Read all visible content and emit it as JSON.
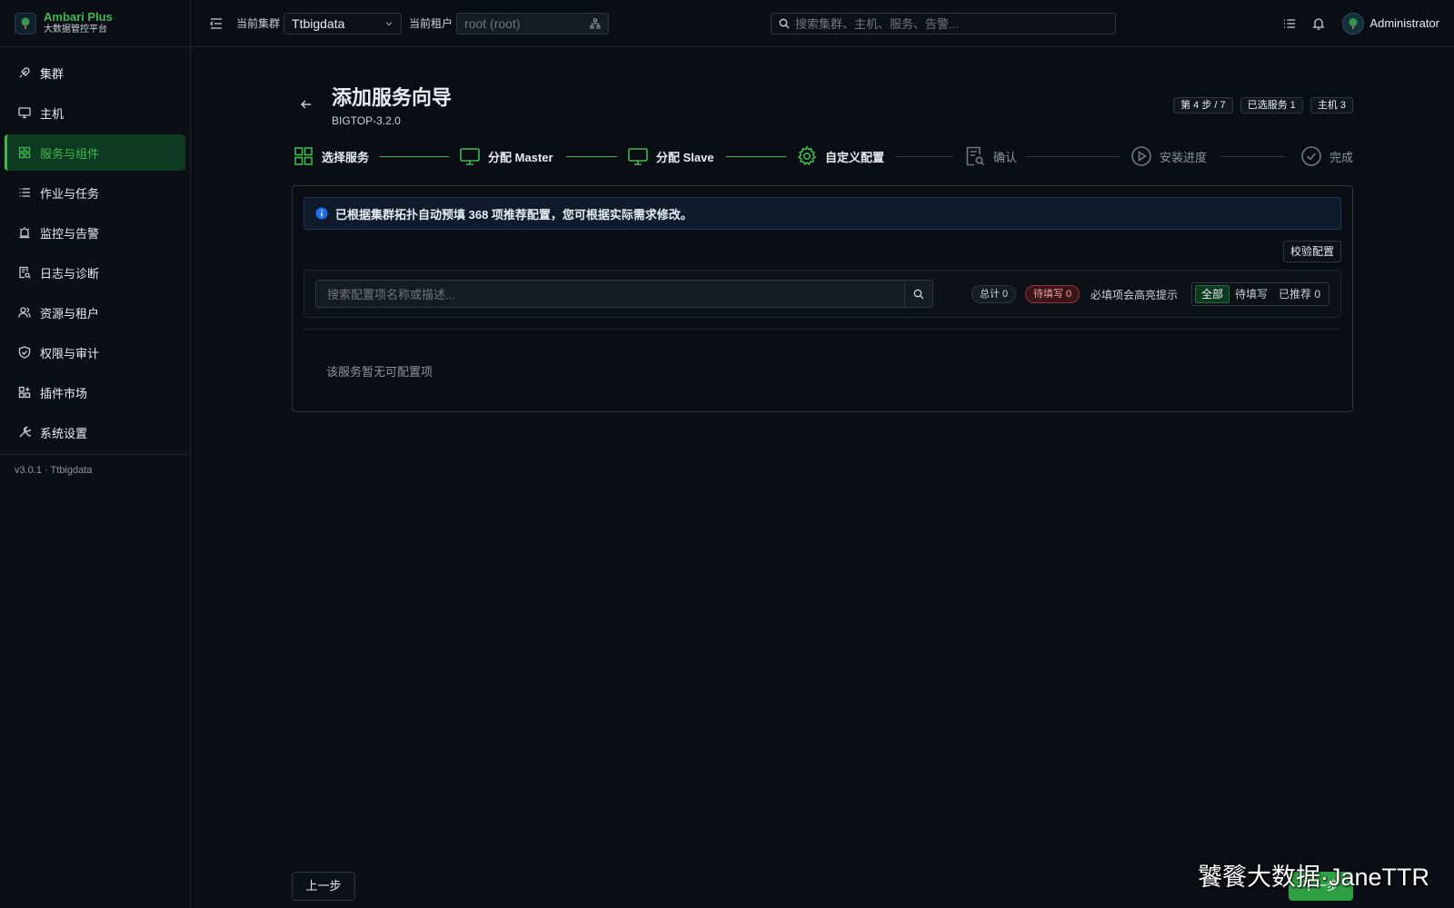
{
  "brand": {
    "name": "Ambari Plus",
    "subtitle": "大数据管控平台"
  },
  "sidebar": {
    "items": [
      {
        "label": "集群",
        "icon": "rocket-icon",
        "active": false
      },
      {
        "label": "主机",
        "icon": "monitor-icon",
        "active": false
      },
      {
        "label": "服务与组件",
        "icon": "grid-icon",
        "active": true
      },
      {
        "label": "作业与任务",
        "icon": "list-icon",
        "active": false
      },
      {
        "label": "监控与告警",
        "icon": "alarm-icon",
        "active": false
      },
      {
        "label": "日志与诊断",
        "icon": "log-search-icon",
        "active": false
      },
      {
        "label": "资源与租户",
        "icon": "users-icon",
        "active": false
      },
      {
        "label": "权限与审计",
        "icon": "shield-icon",
        "active": false
      },
      {
        "label": "插件市场",
        "icon": "apps-icon",
        "active": false
      },
      {
        "label": "系统设置",
        "icon": "wrench-icon",
        "active": false
      }
    ],
    "version": "v3.0.1 · Ttbigdata"
  },
  "topbar": {
    "cluster_label": "当前集群",
    "cluster_value": "Ttbigdata",
    "tenant_label": "当前租户",
    "tenant_placeholder": "root (root)",
    "search_placeholder": "搜索集群、主机、服务、告警...",
    "user": "Administrator"
  },
  "page": {
    "title": "添加服务向导",
    "subtitle": "BIGTOP-3.2.0",
    "badges": [
      "第 4 步 / 7",
      "已选服务 1",
      "主机 3"
    ]
  },
  "steps": [
    {
      "label": "选择服务",
      "status": "done",
      "icon": "grid-icon"
    },
    {
      "label": "分配 Master",
      "status": "done",
      "icon": "monitor-icon"
    },
    {
      "label": "分配 Slave",
      "status": "done",
      "icon": "monitor-icon"
    },
    {
      "label": "自定义配置",
      "status": "current",
      "icon": "gear-icon"
    },
    {
      "label": "确认",
      "status": "pending",
      "icon": "document-search-icon"
    },
    {
      "label": "安装进度",
      "status": "pending",
      "icon": "play-circle-icon"
    },
    {
      "label": "完成",
      "status": "pending",
      "icon": "check-circle-icon"
    }
  ],
  "config": {
    "alert": "已根据集群拓扑自动预填 368 项推荐配置，您可根据实际需求修改。",
    "validate_label": "校验配置",
    "search_placeholder": "搜索配置项名称或描述...",
    "total_label": "总计 0",
    "pending_label": "待填写 0",
    "hint": "必填项会高亮提示",
    "filters": [
      "全部",
      "待填写",
      "已推荐 0"
    ],
    "active_filter": "全部",
    "empty_text": "该服务暂无可配置项"
  },
  "footer": {
    "prev_label": "上一步",
    "next_label": "下一步"
  },
  "watermark": "饕餮大数据·JaneTTR",
  "colors": {
    "accent": "#3fb950",
    "background": "#0a0e14",
    "danger": "#f0a0a0",
    "info": "#1f6feb"
  }
}
